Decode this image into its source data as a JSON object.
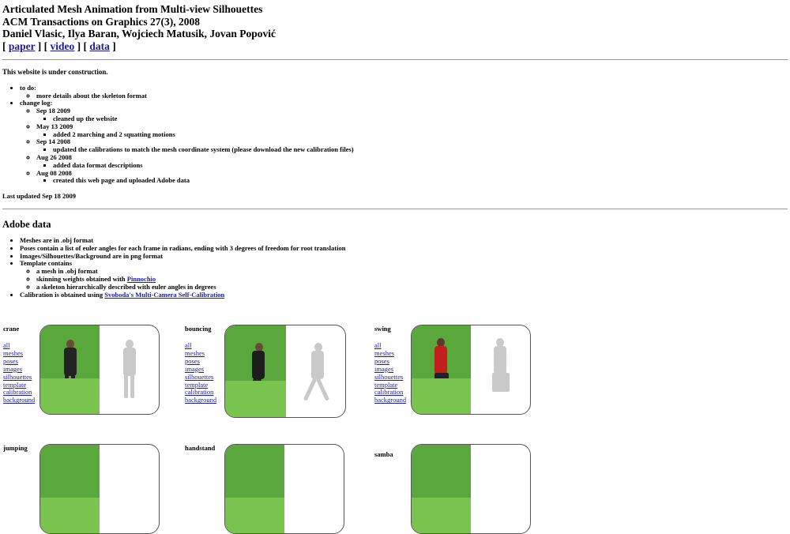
{
  "header": {
    "title": "Articulated Mesh Animation from Multi-view Silhouettes",
    "venue": "ACM Transactions on Graphics 27(3), 2008",
    "authors": "Daniel Vlasic, Ilya Baran, Wojciech Matusik, Jovan Popović",
    "links": [
      {
        "label": "paper"
      },
      {
        "label": "video"
      },
      {
        "label": "data"
      }
    ]
  },
  "notice": "This website is under construction.",
  "todo": {
    "label": "to do:",
    "items": [
      "more details about the skeleton format"
    ]
  },
  "changelog": {
    "label": "change log:",
    "entries": [
      {
        "date": "Sep 18 2009",
        "text": "cleaned up the website"
      },
      {
        "date": "May 13 2009",
        "text": "added 2 marching and 2 squatting motions"
      },
      {
        "date": "Sep 14 2008",
        "text": "updated the calibrations to match the mesh coordinate system (please download the new calibration files)"
      },
      {
        "date": "Aug 26 2008",
        "text": "added data format descriptions"
      },
      {
        "date": "Aug 08 2008",
        "text": "created this web page and uploaded Adobe data"
      }
    ]
  },
  "last_updated": "Last updated Sep 18 2009",
  "adobe": {
    "heading": "Adobe data",
    "bullets": {
      "meshes": "Meshes are in .obj format",
      "poses": "Poses contain a list of euler angles for each frame in radians, ending with 3 degrees of freedom for root translation",
      "images": "Images/Silhouettes/Background are in png format",
      "template": "Template contains",
      "template_sub1": "a mesh in .obj format",
      "template_sub2_prefix": "skinning weights obtained with",
      "template_sub2_link": "Pinnochio",
      "template_sub3": "a skeleton hierarchically described with euler angles in degrees",
      "calibration_prefix": "Calibration is obtained using",
      "calibration_link": "Svoboda's Multi-Camera Self-Calibration"
    }
  },
  "dataset_links": [
    "all",
    "meshes",
    "poses",
    "images",
    "silhouettes",
    "template",
    "calibration",
    "background"
  ],
  "datasets": [
    {
      "name": "crane"
    },
    {
      "name": "bouncing"
    },
    {
      "name": "swing"
    },
    {
      "name": "jumping"
    },
    {
      "name": "handstand"
    },
    {
      "name": "samba"
    }
  ],
  "colors": {
    "link": "#1a1aa6",
    "green_screen": "#5aa83c",
    "rule": "#999999"
  }
}
